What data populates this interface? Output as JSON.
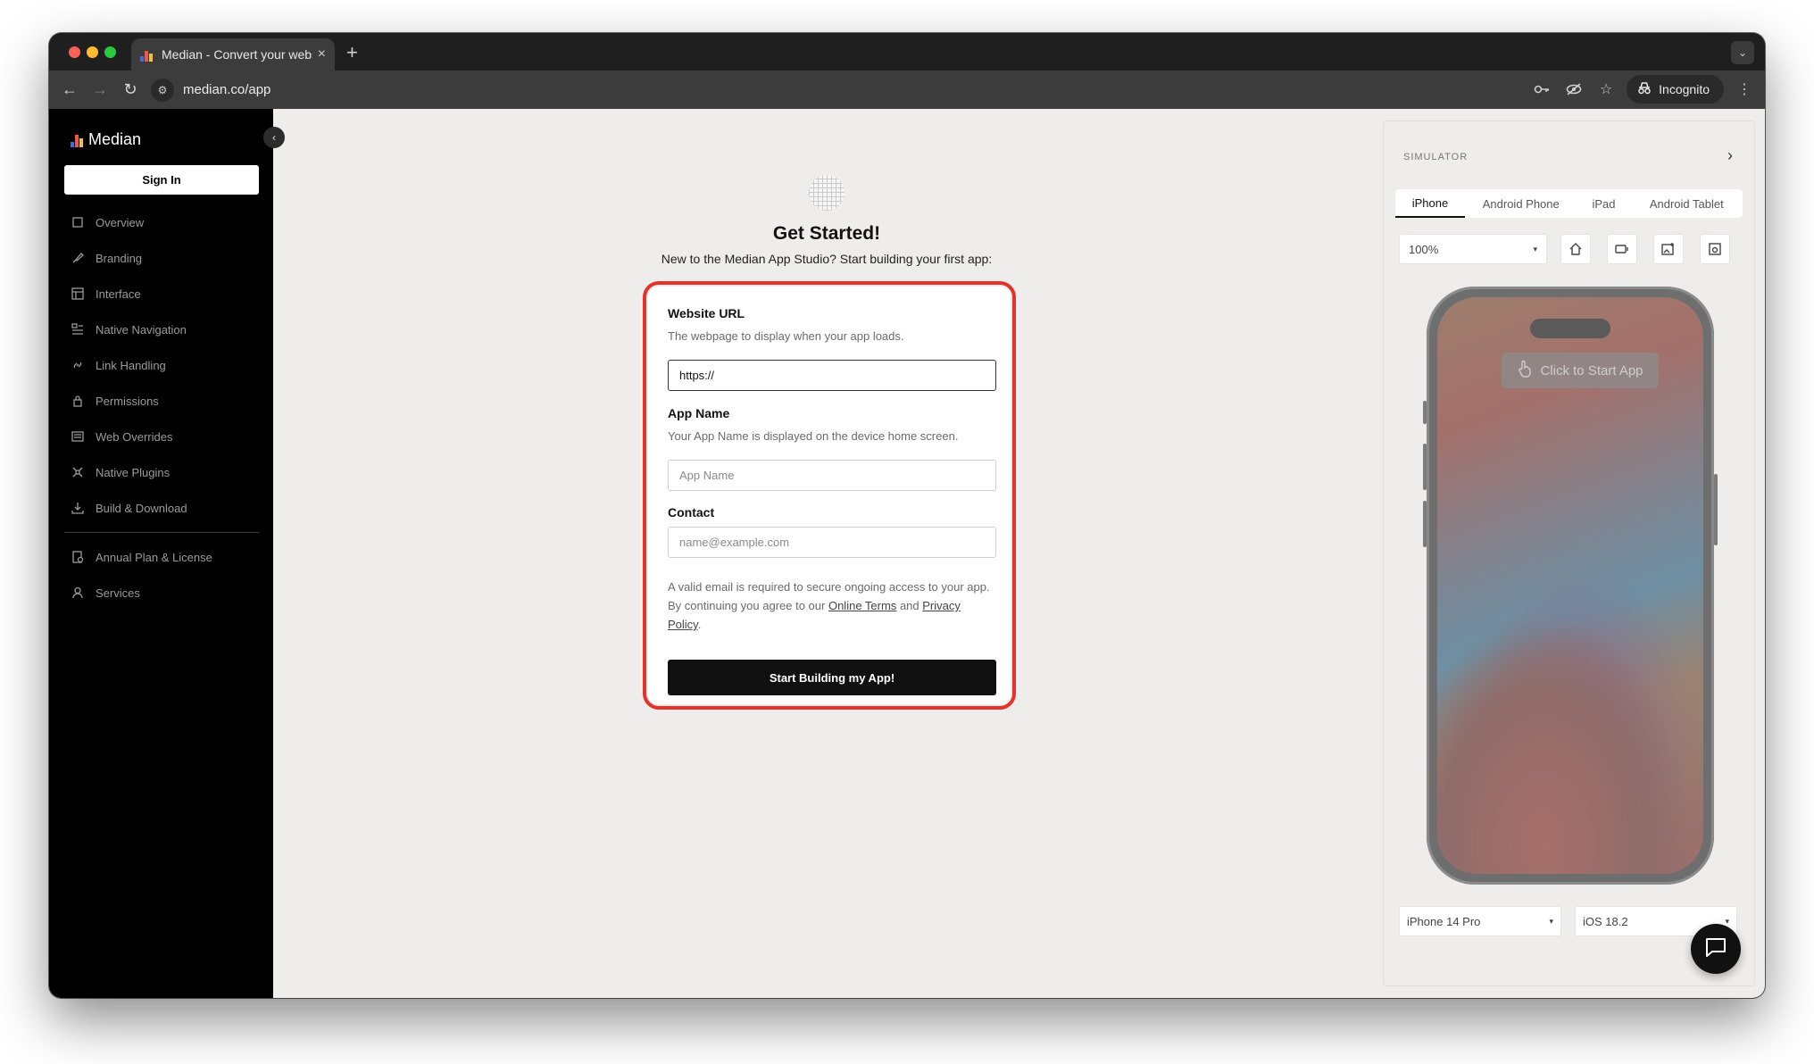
{
  "browser": {
    "tab_title": "Median - Convert your websi",
    "url": "median.co/app",
    "incognito_label": "Incognito"
  },
  "sidebar": {
    "brand": "Median",
    "sign_in": "Sign In",
    "items": [
      {
        "label": "Overview",
        "icon": "square-icon"
      },
      {
        "label": "Branding",
        "icon": "brush-icon"
      },
      {
        "label": "Interface",
        "icon": "layout-icon"
      },
      {
        "label": "Native Navigation",
        "icon": "navigation-icon"
      },
      {
        "label": "Link Handling",
        "icon": "link-icon"
      },
      {
        "label": "Permissions",
        "icon": "lock-icon"
      },
      {
        "label": "Web Overrides",
        "icon": "code-icon"
      },
      {
        "label": "Native Plugins",
        "icon": "plugin-icon"
      },
      {
        "label": "Build & Download",
        "icon": "download-icon"
      }
    ],
    "secondary_items": [
      {
        "label": "Annual Plan & License",
        "icon": "license-icon"
      },
      {
        "label": "Services",
        "icon": "user-icon"
      }
    ]
  },
  "main": {
    "title": "Get Started!",
    "subtitle": "New to the Median App Studio? Start building your first app:",
    "form": {
      "url_label": "Website URL",
      "url_desc": "The webpage to display when your app loads.",
      "url_value": "https://",
      "name_label": "App Name",
      "name_desc": "Your App Name is displayed on the device home screen.",
      "name_placeholder": "App Name",
      "contact_label": "Contact",
      "contact_placeholder": "name@example.com",
      "terms_text": "A valid email is required to secure ongoing access to your app. By continuing you agree to our",
      "terms_link": "Online Terms",
      "terms_and": "and",
      "privacy_link": "Privacy Policy",
      "period": ".",
      "submit": "Start Building my App!"
    }
  },
  "simulator": {
    "heading": "SIMULATOR",
    "tabs": [
      "iPhone",
      "Android Phone",
      "iPad",
      "Android Tablet"
    ],
    "active_tab": "iPhone",
    "zoom": "100%",
    "start_app": "Click to Start App",
    "device": "iPhone 14 Pro",
    "os": "iOS 18.2"
  },
  "colors": {
    "highlight": "#e5332a",
    "cta_bg": "#111111",
    "sidebar_bg": "#000000"
  }
}
